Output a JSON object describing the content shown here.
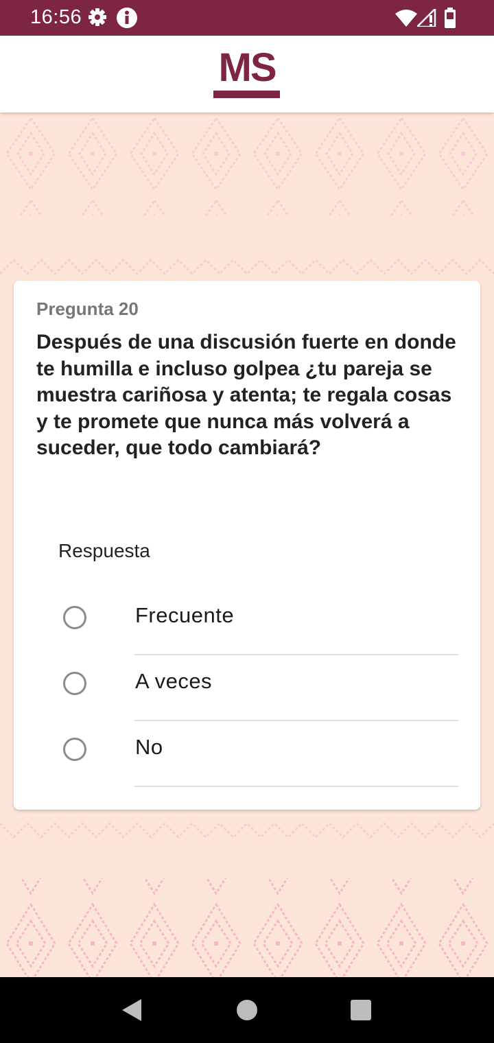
{
  "status_bar": {
    "time": "16:56",
    "left_icons": [
      "gear-icon",
      "info-icon"
    ],
    "right_icons": [
      "wifi-icon",
      "signal-icon",
      "battery-icon"
    ],
    "background_color": "#7e2546"
  },
  "header": {
    "logo_text": "MS",
    "brand_color": "#7e2546"
  },
  "question": {
    "number_label": "Pregunta 20",
    "text": "Después de una discusión fuerte en donde te humilla e incluso golpea ¿tu pareja se muestra cariñosa y atenta; te regala cosas y te promete que nunca más volverá a suceder, que todo cambiará?"
  },
  "answer": {
    "label": "Respuesta",
    "options": [
      {
        "label": "Frecuente",
        "selected": false
      },
      {
        "label": "A veces",
        "selected": false
      },
      {
        "label": "No",
        "selected": false
      }
    ]
  },
  "nav_bar": {
    "buttons": [
      "back-icon",
      "home-icon",
      "recents-icon"
    ]
  },
  "colors": {
    "page_background": "#fde4d8",
    "pattern": "#f6c6cf"
  }
}
